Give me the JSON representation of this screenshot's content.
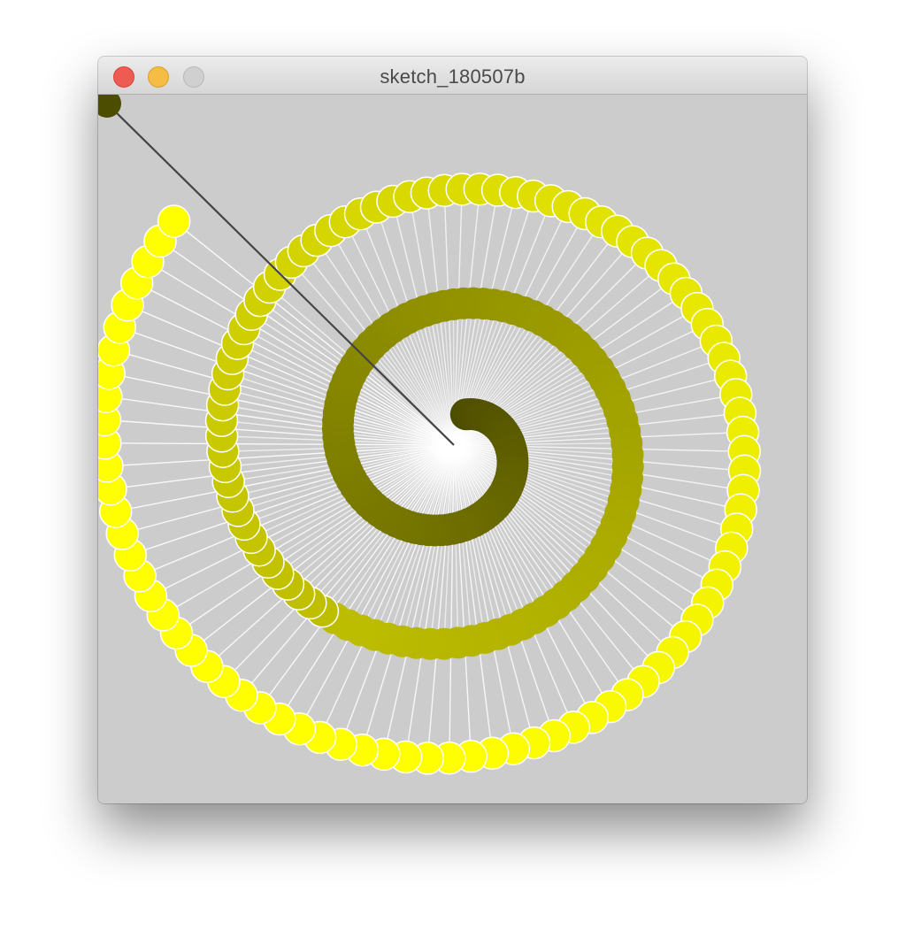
{
  "window": {
    "title": "sketch_180507b",
    "buttons": {
      "close": "close-button",
      "minimize": "minimize-button",
      "zoom": "zoom-button"
    }
  },
  "colors": {
    "canvas_background": "#cccccc",
    "ball_bright": "#ffff00",
    "ball_dark": "#4d4d00",
    "spoke": "#ffffff",
    "close": "#ee5b52",
    "minimize": "#f5bd43",
    "zoom": "#d0d0d0"
  }
}
